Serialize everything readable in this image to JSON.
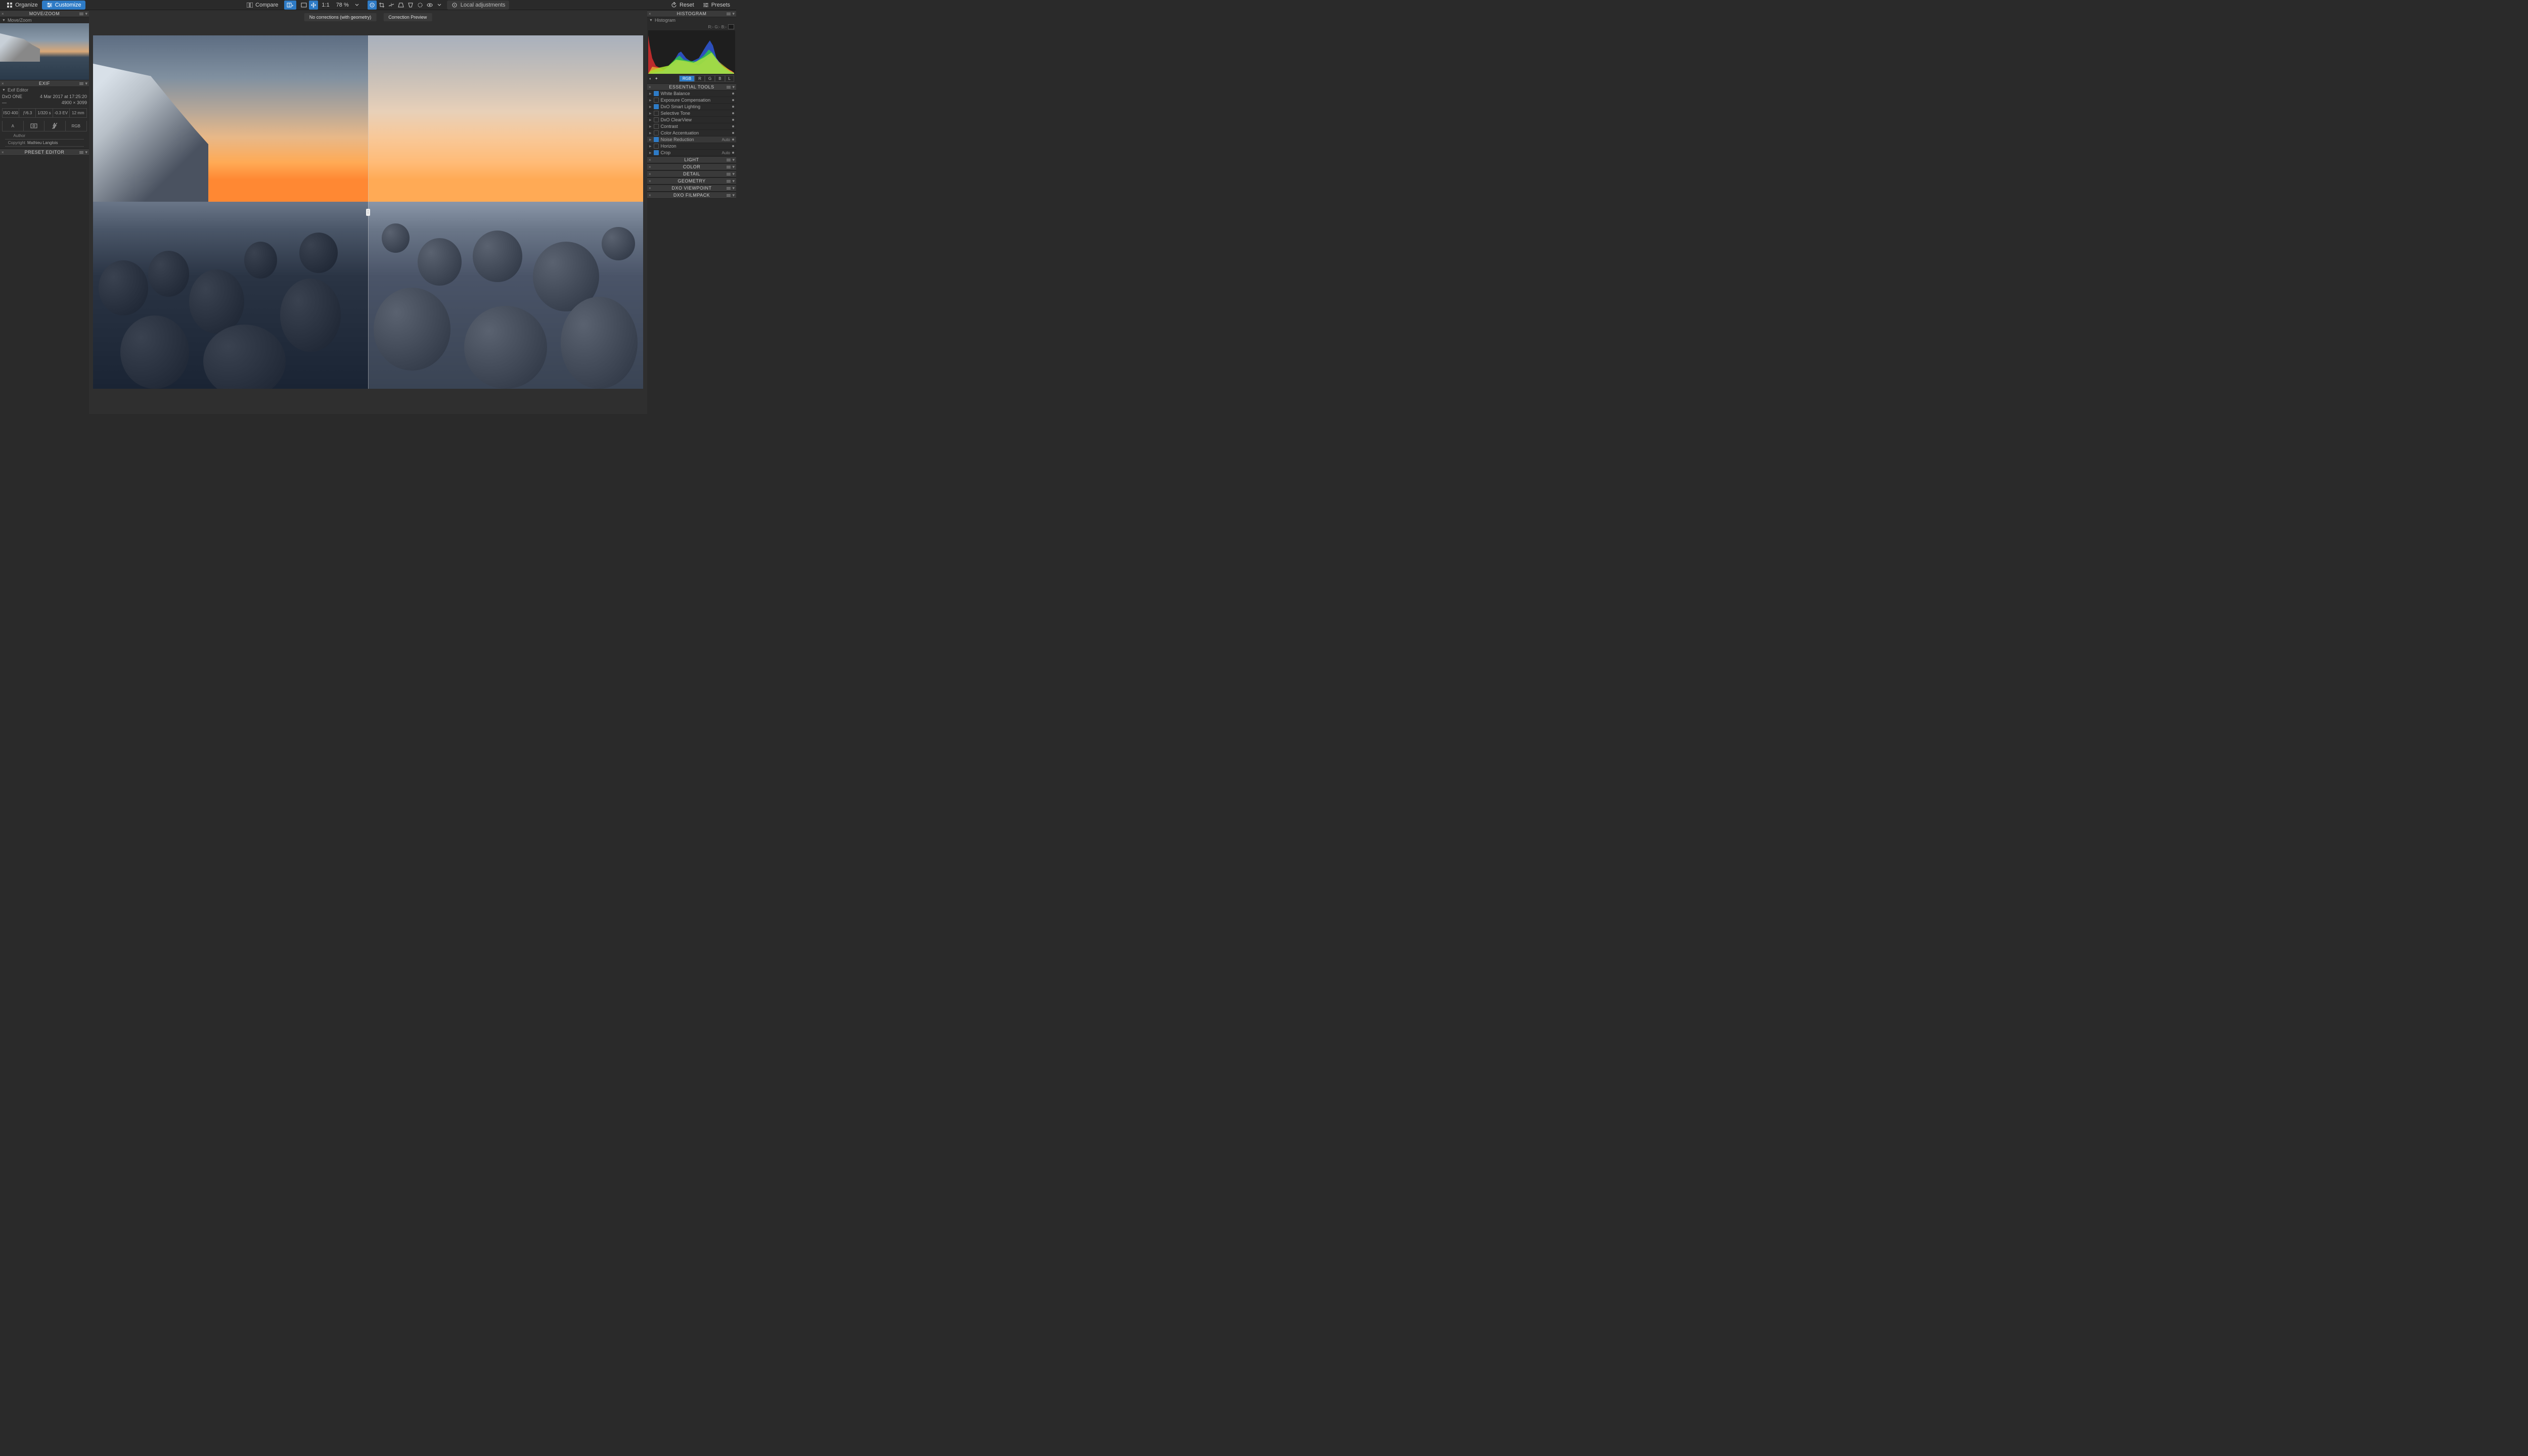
{
  "toolbar": {
    "organize": "Organize",
    "customize": "Customize",
    "compare": "Compare",
    "ratio_11": "1:1",
    "zoom": "78 %",
    "local_adjustments": "Local adjustments",
    "reset": "Reset",
    "presets": "Presets"
  },
  "compare_labels": {
    "left": "No corrections (with geometry)",
    "right": "Correction Preview"
  },
  "left_panel": {
    "move_zoom": {
      "header": "MOVE/ZOOM",
      "sub": "Move/Zoom"
    },
    "exif": {
      "header": "EXIF",
      "sub": "Exif Editor",
      "camera": "DxO ONE",
      "date": "4 Mar 2017 at 17:25:20",
      "lens_row": "—",
      "dimensions": "4900 × 3099",
      "iso": "ISO 400",
      "aperture": "ƒ/6.3",
      "shutter": "1/320 s",
      "ev": "-0.3 EV",
      "focal": "12 mm",
      "mode1": "A",
      "mode2_icon": "center-weighted",
      "mode3_icon": "no-flash",
      "mode4": "RGB",
      "author_label": "Author",
      "copyright_label": "Copyright",
      "copyright_value": "Mathieu Langlois"
    },
    "preset_editor": {
      "header": "PRESET EDITOR"
    }
  },
  "right_panel": {
    "histogram": {
      "header": "HISTOGRAM",
      "sub": "Histogram",
      "readout": "R:- G:- B:-",
      "channels": [
        "RGB",
        "R",
        "G",
        "B",
        "L"
      ]
    },
    "essential_tools": {
      "header": "ESSENTIAL TOOLS",
      "items": [
        {
          "label": "White Balance",
          "checked": true,
          "auto": ""
        },
        {
          "label": "Exposure Compensation",
          "checked": false,
          "auto": ""
        },
        {
          "label": "DxO Smart Lighting",
          "checked": true,
          "auto": ""
        },
        {
          "label": "Selective Tone",
          "checked": false,
          "auto": ""
        },
        {
          "label": "DxO ClearView",
          "checked": false,
          "auto": ""
        },
        {
          "label": "Contrast",
          "checked": false,
          "auto": ""
        },
        {
          "label": "Color Accentuation",
          "checked": false,
          "auto": ""
        },
        {
          "label": "Noise Reduction",
          "checked": true,
          "auto": "Auto",
          "highlighted": true
        },
        {
          "label": "Horizon",
          "checked": false,
          "auto": ""
        },
        {
          "label": "Crop",
          "checked": true,
          "auto": "Auto"
        }
      ]
    },
    "sections": [
      "LIGHT",
      "COLOR",
      "DETAIL",
      "GEOMETRY",
      "DXO VIEWPOINT",
      "DXO FILMPACK"
    ]
  }
}
